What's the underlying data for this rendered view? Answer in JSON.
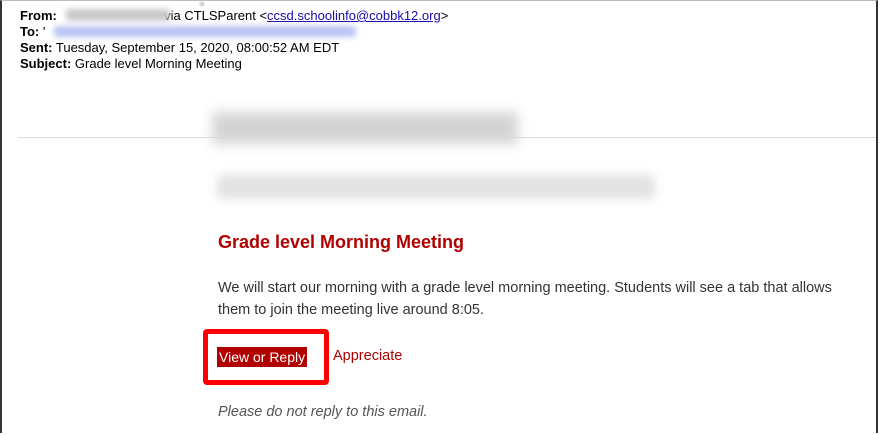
{
  "header": {
    "from_label": "From:",
    "from_via": " via CTLSParent <",
    "from_email": "ccsd.schoolinfo@cobbk12.org",
    "from_close": ">",
    "to_label": "To:",
    "to_prefix": "'",
    "sent_label": "Sent:",
    "sent_value": " Tuesday, September 15, 2020, 08:00:52 AM EDT",
    "subject_label": "Subject:",
    "subject_value": " Grade level Morning Meeting"
  },
  "message": {
    "title": "Grade level Morning Meeting",
    "body": "We will start our morning with a grade level morning meeting. Students will see a tab that allows them to join the meeting live around 8:05.",
    "view_reply_label": "View or Reply",
    "appreciate_label": "Appreciate",
    "footer_note": "Please do not reply to this email."
  },
  "colors": {
    "accent_red": "#b00000",
    "highlight_box": "#ff0000",
    "link_blue": "#1a0dab"
  }
}
